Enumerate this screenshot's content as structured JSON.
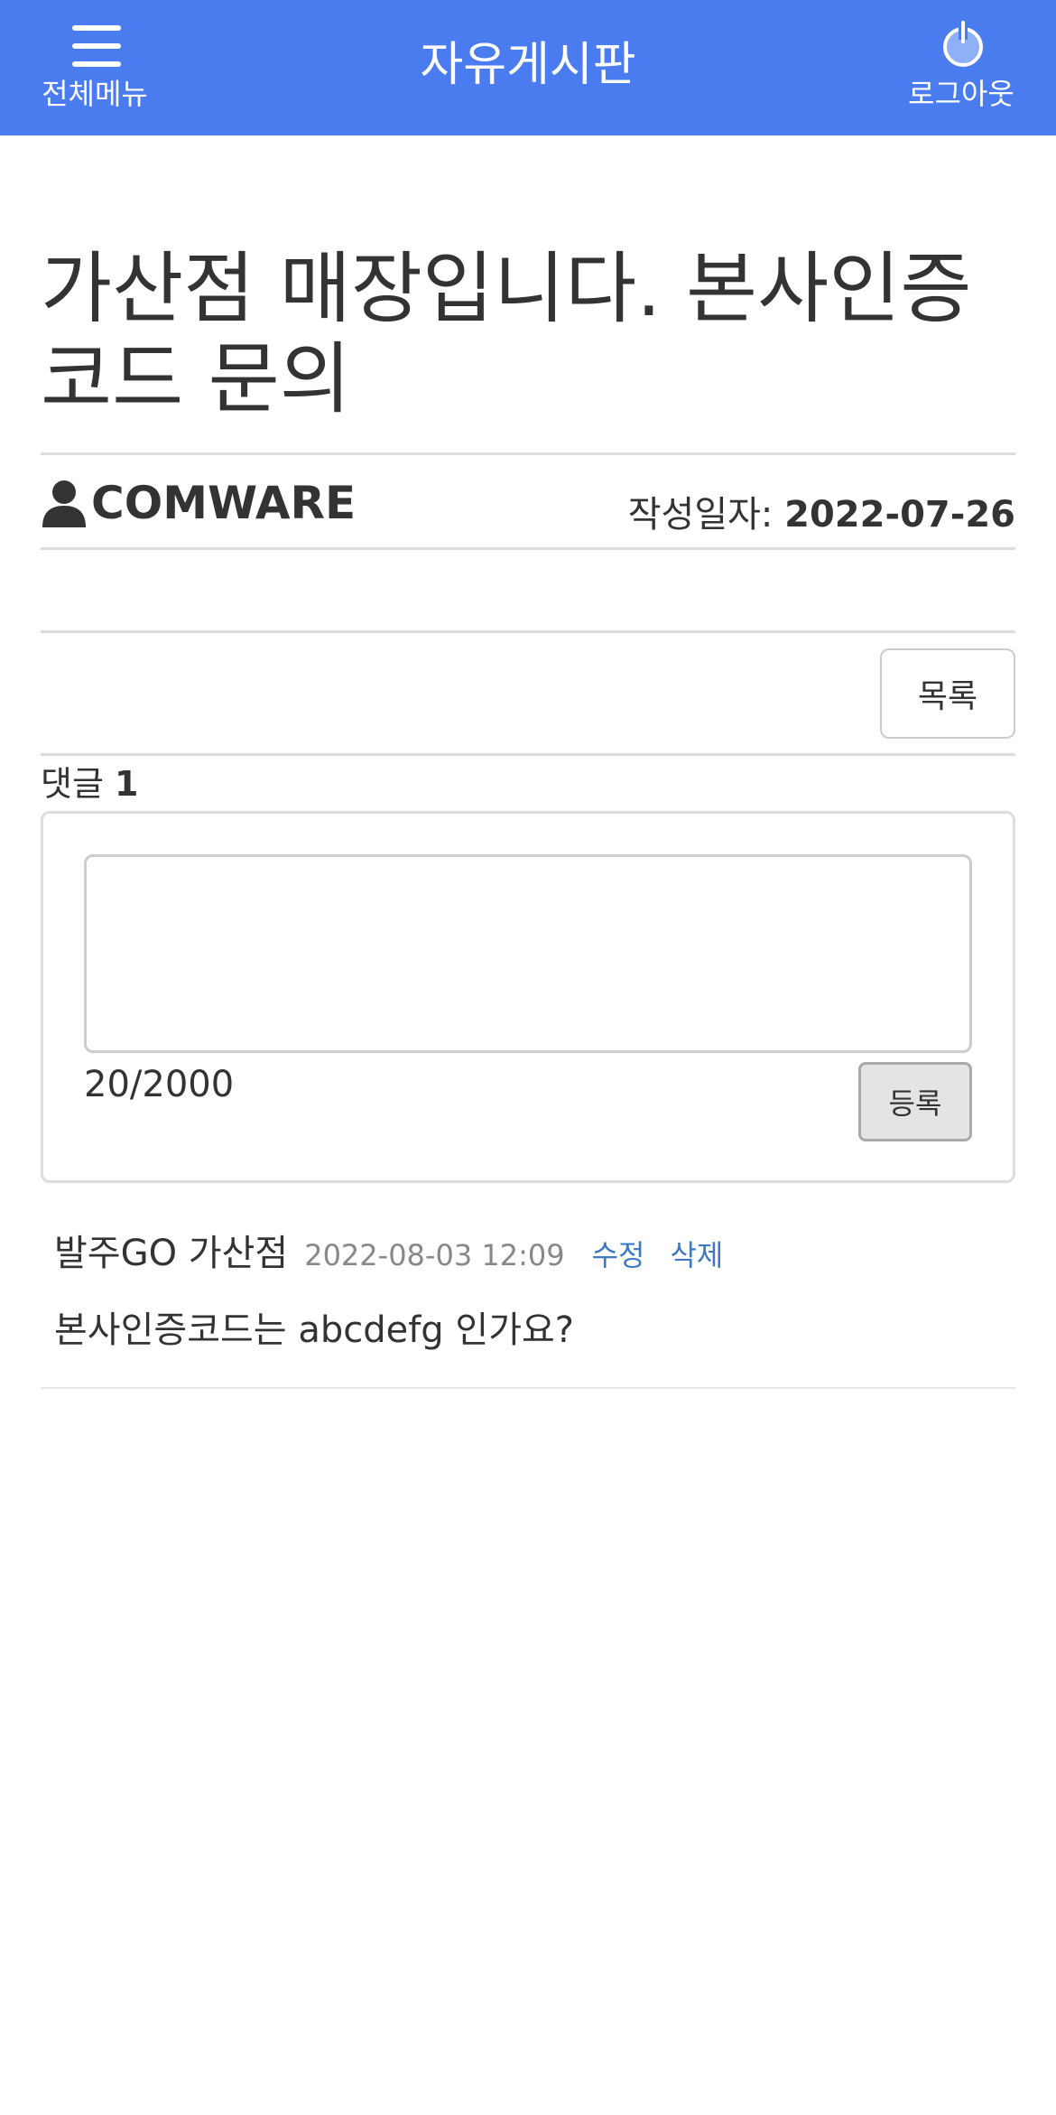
{
  "header": {
    "menu_label": "전체메뉴",
    "title": "자유게시판",
    "logout_label": "로그아웃",
    "color": "#4a7cef"
  },
  "post": {
    "title": "가산점 매장입니다. 본사인증코드 문의",
    "author": "COMWARE",
    "date_label": "작성일자:",
    "date": "2022-07-26"
  },
  "actions": {
    "list_label": "목록"
  },
  "comments": {
    "count_label": "댓글",
    "count": "1",
    "form": {
      "input_value": "",
      "char_count": "20/2000",
      "submit_label": "등록"
    },
    "items": [
      {
        "author": "발주GO 가산점",
        "date": "2022-08-03 12:09",
        "edit_label": "수정",
        "delete_label": "삭제",
        "text": "본사인증코드는 abcdefg 인가요?"
      }
    ]
  },
  "icons": {
    "menu": "hamburger-icon",
    "logout": "power-icon",
    "author": "user-icon"
  }
}
